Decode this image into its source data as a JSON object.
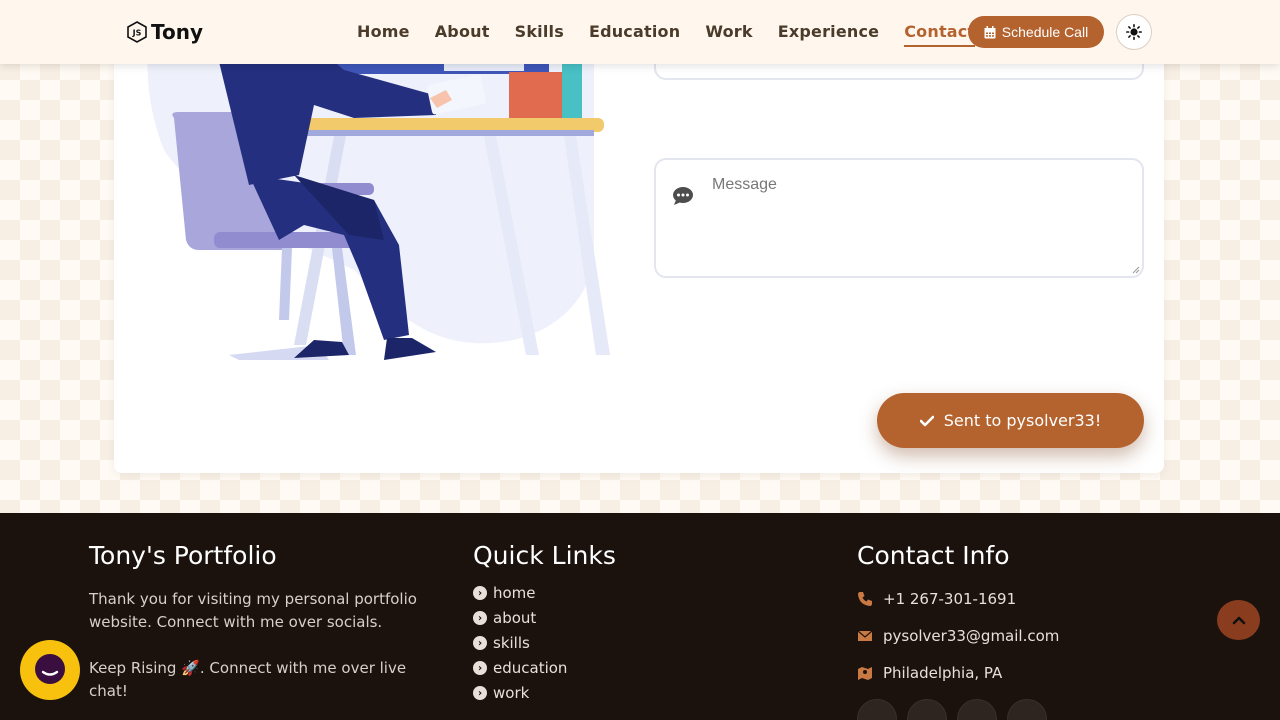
{
  "nav": {
    "brand": "Tony",
    "links": [
      "Home",
      "About",
      "Skills",
      "Education",
      "Work",
      "Experience",
      "Contact"
    ],
    "active": "Contact",
    "schedule_label": "Schedule Call"
  },
  "contact": {
    "message_placeholder": "Message",
    "send_label": "Sent to pysolver33!"
  },
  "footer": {
    "about": {
      "title": "Tony's Portfolio",
      "text1": "Thank you for visiting my personal portfolio website. Connect with me over socials.",
      "text2": "Keep Rising 🚀. Connect with me over live chat!"
    },
    "quick_links": {
      "title": "Quick Links",
      "items": [
        "home",
        "about",
        "skills",
        "education",
        "work"
      ]
    },
    "contact_info": {
      "title": "Contact Info",
      "phone": "+1 267-301-1691",
      "email": "pysolver33@gmail.com",
      "location": "Philadelphia, PA"
    }
  },
  "colors": {
    "accent": "#b4622e",
    "footer_bg": "#1b120e",
    "chat_widget": "#f7c10e"
  },
  "icons": {
    "brand": "js-logo-icon",
    "schedule": "calendar-icon",
    "theme": "sun-icon",
    "message": "comment-icon",
    "send": "check-icon",
    "quick_link": "chevron-circle-right-icon",
    "phone": "phone-icon",
    "email": "envelope-icon",
    "location": "map-marker-icon",
    "scroll_top": "chevron-up-icon",
    "chat": "chat-bubble-icon"
  }
}
